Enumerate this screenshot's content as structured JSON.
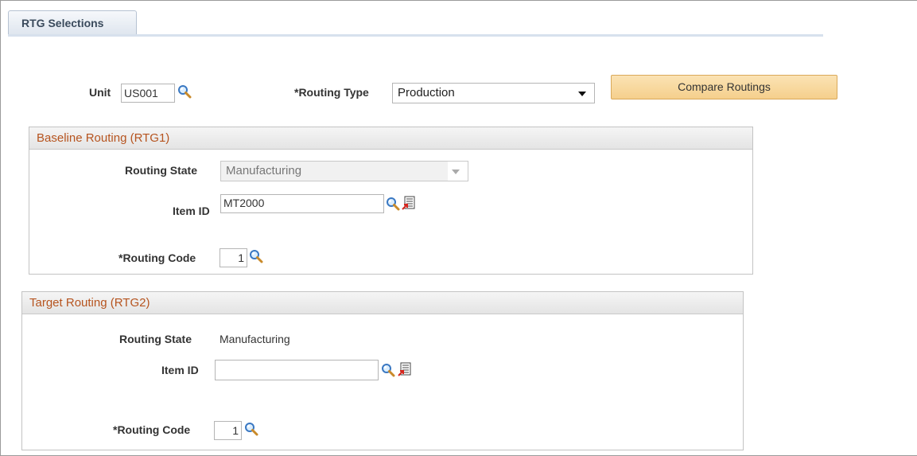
{
  "tab": {
    "label": "RTG Selections"
  },
  "header": {
    "unit_label": "Unit",
    "unit_value": "US001",
    "routing_type_label": "*Routing Type",
    "routing_type_value": "Production",
    "compare_button": "Compare Routings"
  },
  "baseline": {
    "title": "Baseline Routing (RTG1)",
    "routing_state_label": "Routing State",
    "routing_state_value": "Manufacturing",
    "item_id_label": "Item ID",
    "item_id_value": "MT2000",
    "routing_code_label": "*Routing Code",
    "routing_code_value": "1"
  },
  "target": {
    "title": "Target Routing (RTG2)",
    "routing_state_label": "Routing State",
    "routing_state_value": "Manufacturing",
    "item_id_label": "Item ID",
    "item_id_value": "",
    "routing_code_label": "*Routing Code",
    "routing_code_value": "1"
  },
  "colors": {
    "group_title": "#b6541f",
    "button_bg": "#f5cf8c",
    "tab_bg": "#dfe6ef"
  },
  "icons": {
    "lookup": "magnifier-lookup-icon",
    "detail": "item-detail-report-icon"
  }
}
